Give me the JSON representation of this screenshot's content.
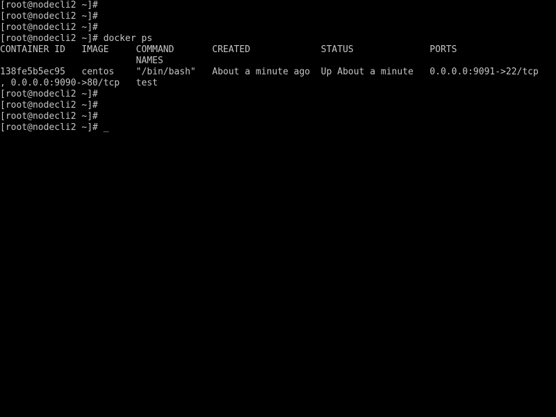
{
  "terminal": {
    "background_color": "#000000",
    "foreground_color": "#c6c6c6",
    "columns": 100,
    "rows": 37,
    "prompt": "[root@nodecli2 ~]#",
    "hostname": "nodecli2",
    "user": "root",
    "cwd_symbol": "~",
    "cursor_glyph": "_"
  },
  "command": {
    "name": "docker ps",
    "full_line": "[root@nodecli2 ~]# docker ps"
  },
  "docker_ps": {
    "type": "table",
    "headers": [
      "CONTAINER ID",
      "IMAGE",
      "COMMAND",
      "CREATED",
      "STATUS",
      "PORTS",
      "NAMES"
    ],
    "column_starts": [
      0,
      15,
      25,
      39,
      60,
      80,
      0
    ],
    "rows": [
      {
        "container_id": "138fe5b5ec95",
        "image": "centos",
        "command": "\"/bin/bash\"",
        "created": "About a minute ago",
        "status": "Up About a minute",
        "ports": "0.0.0.0:9091->22/tcp, 0.0.0.0:9090->80/tcp",
        "names": "test"
      }
    ]
  },
  "lines": [
    "[root@nodecli2 ~]#",
    "[root@nodecli2 ~]#",
    "[root@nodecli2 ~]#",
    "[root@nodecli2 ~]# docker ps",
    "CONTAINER ID   IMAGE     COMMAND       CREATED             STATUS              PORTS",
    "                         NAMES",
    "138fe5b5ec95   centos    \"/bin/bash\"   About a minute ago  Up About a minute   0.0.0.0:9091->22/tcp",
    ", 0.0.0.0:9090->80/tcp   test",
    "[root@nodecli2 ~]#",
    "[root@nodecli2 ~]#",
    "[root@nodecli2 ~]#",
    "[root@nodecli2 ~]# "
  ],
  "line_roles": [
    "prompt-line",
    "prompt-line",
    "prompt-line",
    "command-line",
    "table-header-line",
    "table-header-wrap-line",
    "table-row-line",
    "table-row-wrap-line",
    "prompt-line",
    "prompt-line",
    "prompt-line",
    "prompt-line-active"
  ]
}
